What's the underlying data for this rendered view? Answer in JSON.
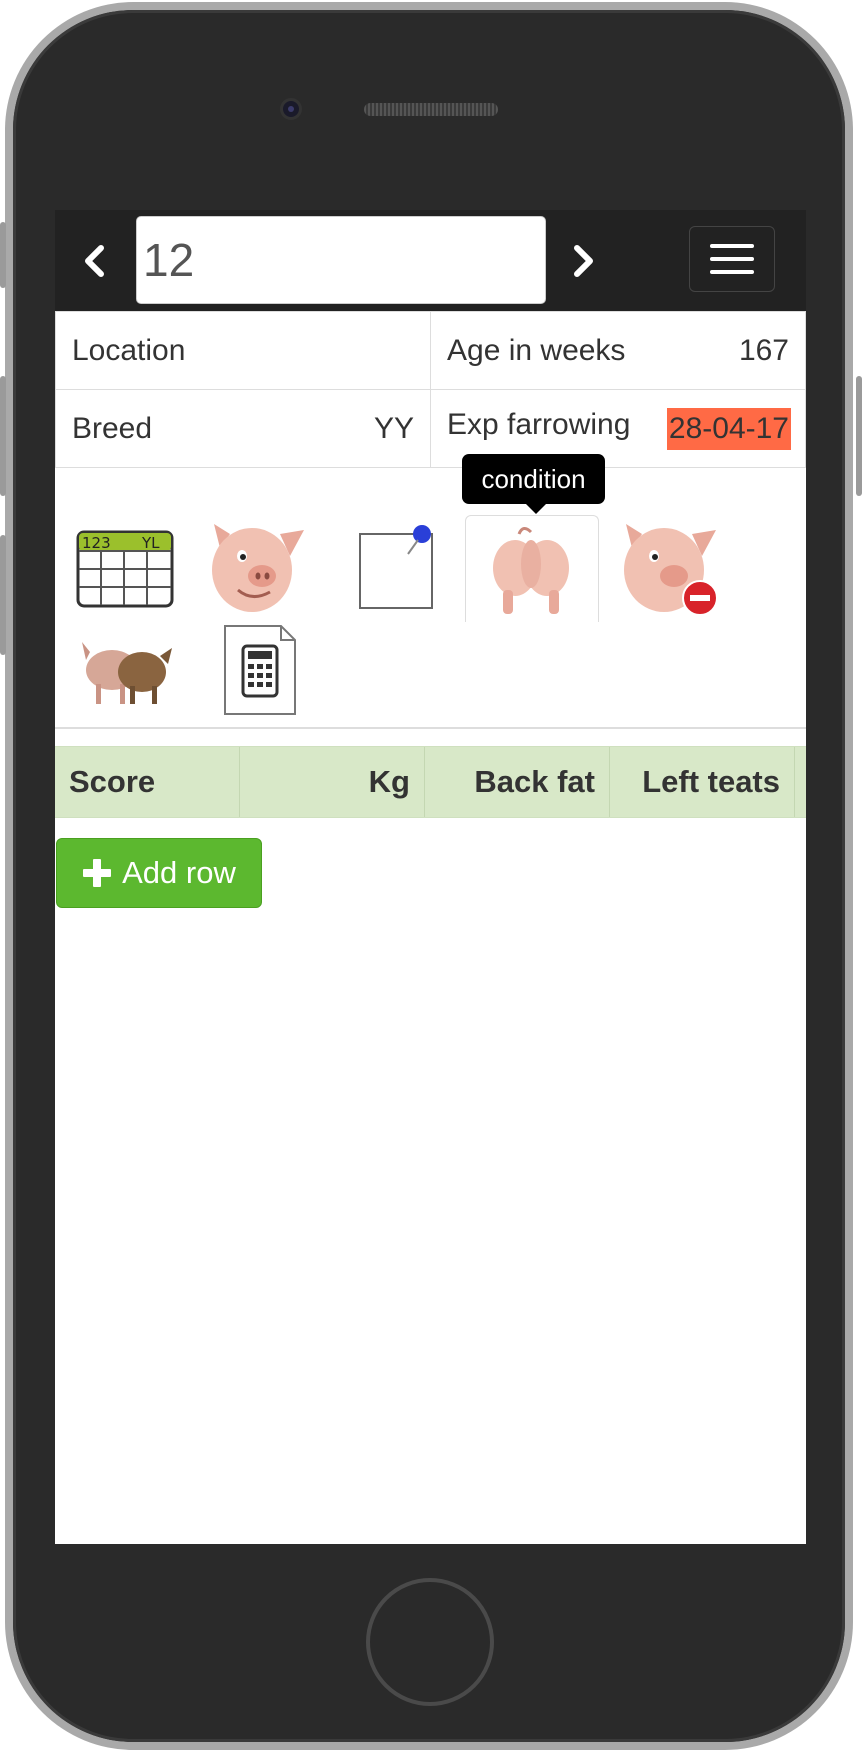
{
  "header": {
    "animal_number": "12",
    "prev_icon": "chevron-left-icon",
    "next_icon": "chevron-right-icon",
    "menu_icon": "hamburger-menu-icon"
  },
  "info": {
    "location_label": "Location",
    "location_value": "",
    "age_label": "Age in weeks",
    "age_value": "167",
    "breed_label": "Breed",
    "breed_value": "YY",
    "farrowing_label": "Exp farrowing",
    "farrowing_value": "28-04-17",
    "farrowing_highlight": "#ff6a45"
  },
  "tooltip": {
    "text": "condition"
  },
  "actions": [
    {
      "icon": "calendar-table-icon"
    },
    {
      "icon": "pig-head-icon"
    },
    {
      "icon": "note-pin-icon"
    },
    {
      "icon": "pig-rear-condition-icon"
    },
    {
      "icon": "pig-remove-icon"
    },
    {
      "icon": "pig-group-icon"
    },
    {
      "icon": "calculator-icon"
    }
  ],
  "grid": {
    "columns": [
      "Score",
      "Kg",
      "Back fat",
      "Left teats"
    ],
    "header_color": "#d8e8c8"
  },
  "add_row": {
    "label": "Add row",
    "color": "#5cb82f"
  }
}
